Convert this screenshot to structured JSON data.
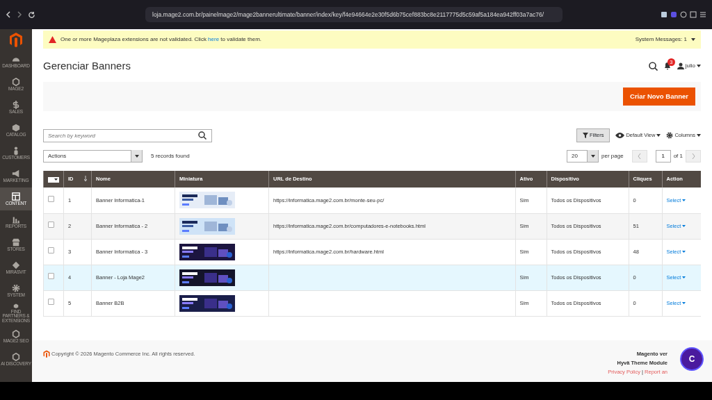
{
  "browser": {
    "url": "loja.mage2.com.br/painelmage2/mage2bannerultimate/banner/index/key/f4e94664e2e30f5d6b75cef883bc8e2117775d5c59af5a184ea942ff03a7ac76/"
  },
  "sidebar": {
    "items": [
      {
        "label": "DASHBOARD",
        "selected": false
      },
      {
        "label": "MAGE2",
        "selected": false
      },
      {
        "label": "SALES",
        "selected": false
      },
      {
        "label": "CATALOG",
        "selected": false
      },
      {
        "label": "CUSTOMERS",
        "selected": false
      },
      {
        "label": "MARKETING",
        "selected": false
      },
      {
        "label": "CONTENT",
        "selected": true
      },
      {
        "label": "REPORTS",
        "selected": false
      },
      {
        "label": "STORES",
        "selected": false
      },
      {
        "label": "MIRASVIT",
        "selected": false
      },
      {
        "label": "SYSTEM",
        "selected": false
      },
      {
        "label": "FIND PARTNERS & EXTENSIONS",
        "selected": false
      },
      {
        "label": "MAGE2 SEO",
        "selected": false
      },
      {
        "label": "AI DISCOVERY",
        "selected": false
      }
    ]
  },
  "notice": {
    "before": "One or more Mageplaza extensions are not validated. Click",
    "link": "here",
    "after": "to validate them.",
    "system_messages": "System Messages: 1"
  },
  "header": {
    "title": "Gerenciar Banners",
    "notifications": "3",
    "user": "julio"
  },
  "add_button": "Criar Novo Banner",
  "search": {
    "placeholder": "Search by keyword"
  },
  "toolbar": {
    "filters": "Filters",
    "view": "Default View",
    "columns": "Columns",
    "actions": "Actions",
    "records": "5 records found",
    "per_page_value": "20",
    "per_page": "per page",
    "page": "1",
    "of": "of 1"
  },
  "table": {
    "select_all": {
      "checked": false
    },
    "columns": [
      "ID",
      "Nome",
      "Miniatura",
      "URL de Destino",
      "Ativo",
      "Dispositivo",
      "Cliques",
      "Action"
    ],
    "rows": [
      {
        "id": "1",
        "name": "Banner Informatica-1",
        "url": "https://informatica.mage2.com.br/monte-seu-pc/",
        "active": "Sim",
        "device": "Todos os Dispositivos",
        "clicks": "0",
        "action": "Select",
        "highlighted": false,
        "checked": false
      },
      {
        "id": "2",
        "name": "Banner Informatica - 2",
        "url": "https://informatica.mage2.com.br/computadores-e-notebooks.html",
        "active": "Sim",
        "device": "Todos os Dispositivos",
        "clicks": "51",
        "action": "Select",
        "highlighted": false,
        "checked": false
      },
      {
        "id": "3",
        "name": "Banner Informatica - 3",
        "url": "https://informatica.mage2.com.br/hardware.html",
        "active": "Sim",
        "device": "Todos os Dispositivos",
        "clicks": "48",
        "action": "Select",
        "highlighted": false,
        "checked": false
      },
      {
        "id": "4",
        "name": "Banner - Loja Mage2",
        "active": "Sim",
        "device": "Todos os Dispositivos",
        "clicks": "0",
        "action": "Select",
        "highlighted": true,
        "checked": false
      },
      {
        "id": "5",
        "name": "Banner B2B",
        "active": "Sim",
        "device": "Todos os Dispositivos",
        "clicks": "0",
        "action": "Select",
        "highlighted": false,
        "checked": false
      }
    ]
  },
  "footer": {
    "copyright": "Copyright © 2026 Magento Commerce Inc. All rights reserved.",
    "version": "Magento ver",
    "theme": "Hyvä Theme Module",
    "privacy": "Privacy Policy",
    "separator": "|",
    "report": "Report an",
    "chat": "C"
  }
}
